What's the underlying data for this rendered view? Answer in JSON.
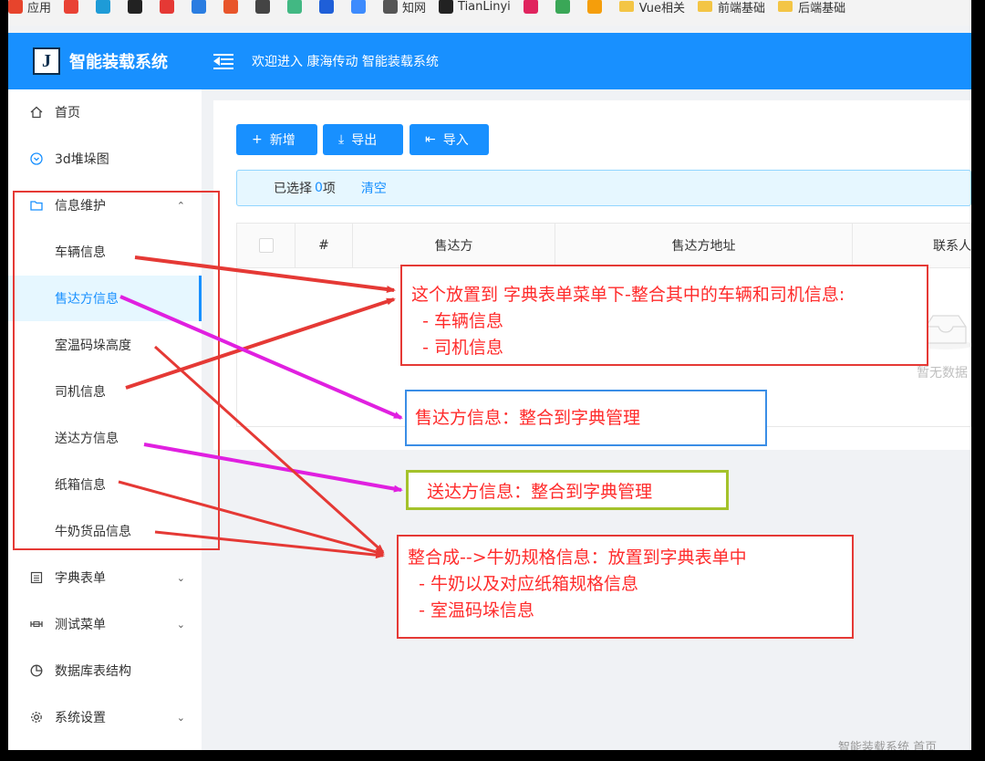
{
  "bookmarks": [
    {
      "label": "应用",
      "icon": "apps-grid-icon",
      "color": "#e7442c"
    },
    {
      "label": "",
      "icon": "chrome-icon",
      "color": "#e94235"
    },
    {
      "label": "",
      "icon": "bilibili-icon",
      "color": "#1e9bd7"
    },
    {
      "label": "",
      "icon": "github-icon",
      "color": "#222222"
    },
    {
      "label": "",
      "icon": "g-icon",
      "color": "#e53935"
    },
    {
      "label": "",
      "icon": "webstorm-icon",
      "color": "#2a7de1"
    },
    {
      "label": "",
      "icon": "c-icon",
      "color": "#e8552b"
    },
    {
      "label": "",
      "icon": "cursor-icon",
      "color": "#444444"
    },
    {
      "label": "",
      "icon": "vue-icon",
      "color": "#42b883"
    },
    {
      "label": "",
      "icon": "bootstrap-icon",
      "color": "#1f5fd8"
    },
    {
      "label": "",
      "icon": "layers-icon",
      "color": "#3d8bfd"
    },
    {
      "label": "知网",
      "icon": "globe-icon",
      "color": "#555555"
    },
    {
      "label": "TianLinyi",
      "icon": "notion-icon",
      "color": "#222222"
    },
    {
      "label": "",
      "icon": "php-icon",
      "color": "#e0245e"
    },
    {
      "label": "",
      "icon": "leaf-icon",
      "color": "#3aa757"
    },
    {
      "label": "",
      "icon": "blocks-icon",
      "color": "#f59e0b"
    },
    {
      "label": "Vue相关",
      "icon": "folder-icon",
      "color": "#f3c545"
    },
    {
      "label": "前端基础",
      "icon": "folder-icon",
      "color": "#f3c545"
    },
    {
      "label": "后端基础",
      "icon": "folder-icon",
      "color": "#f3c545"
    }
  ],
  "header": {
    "logo_letter": "J",
    "title": "智能装载系统",
    "welcome": "欢迎进入 康海传动 智能装载系统"
  },
  "sidebar": {
    "items": [
      {
        "label": "首页",
        "icon": "home-icon"
      },
      {
        "label": "3d堆垛图",
        "icon": "circle-chevron-icon"
      },
      {
        "label": "信息维护",
        "icon": "folder-icon",
        "expanded": true
      },
      {
        "label": "车辆信息"
      },
      {
        "label": "售达方信息",
        "active": true
      },
      {
        "label": "室温码垛高度"
      },
      {
        "label": "司机信息"
      },
      {
        "label": "送达方信息"
      },
      {
        "label": "纸箱信息"
      },
      {
        "label": "牛奶货品信息"
      },
      {
        "label": "字典表单",
        "icon": "list-icon"
      },
      {
        "label": "测试菜单",
        "icon": "tool-icon"
      },
      {
        "label": "数据库表结构",
        "icon": "pie-icon"
      },
      {
        "label": "系统设置",
        "icon": "gear-icon"
      }
    ]
  },
  "toolbar": {
    "add": "新增",
    "export": "导出",
    "import": "导入",
    "add_icon": "+",
    "export_icon": "⤓",
    "import_icon": "⇤"
  },
  "selection": {
    "prefix": "已选择",
    "count": "0",
    "suffix": "项",
    "clear": "清空"
  },
  "table": {
    "columns": [
      "#",
      "售达方",
      "售达方地址",
      "联系人"
    ],
    "empty_text": "暂无数据"
  },
  "footer": "智能装载系统 首页",
  "annotations": {
    "note1": "这个放置到 字典表单菜单下-整合其中的车辆和司机信息:\n  - 车辆信息\n  - 司机信息",
    "note2": "售达方信息：整合到字典管理",
    "note3": "  送达方信息：整合到字典管理",
    "note4": "整合成-->牛奶规格信息：放置到字典表单中\n  - 牛奶以及对应纸箱规格信息\n  - 室温码垛信息",
    "colors": {
      "red": "#e53935",
      "magenta": "#e020e0",
      "blue": "#3a8ee6",
      "green": "#a4c22b"
    }
  }
}
